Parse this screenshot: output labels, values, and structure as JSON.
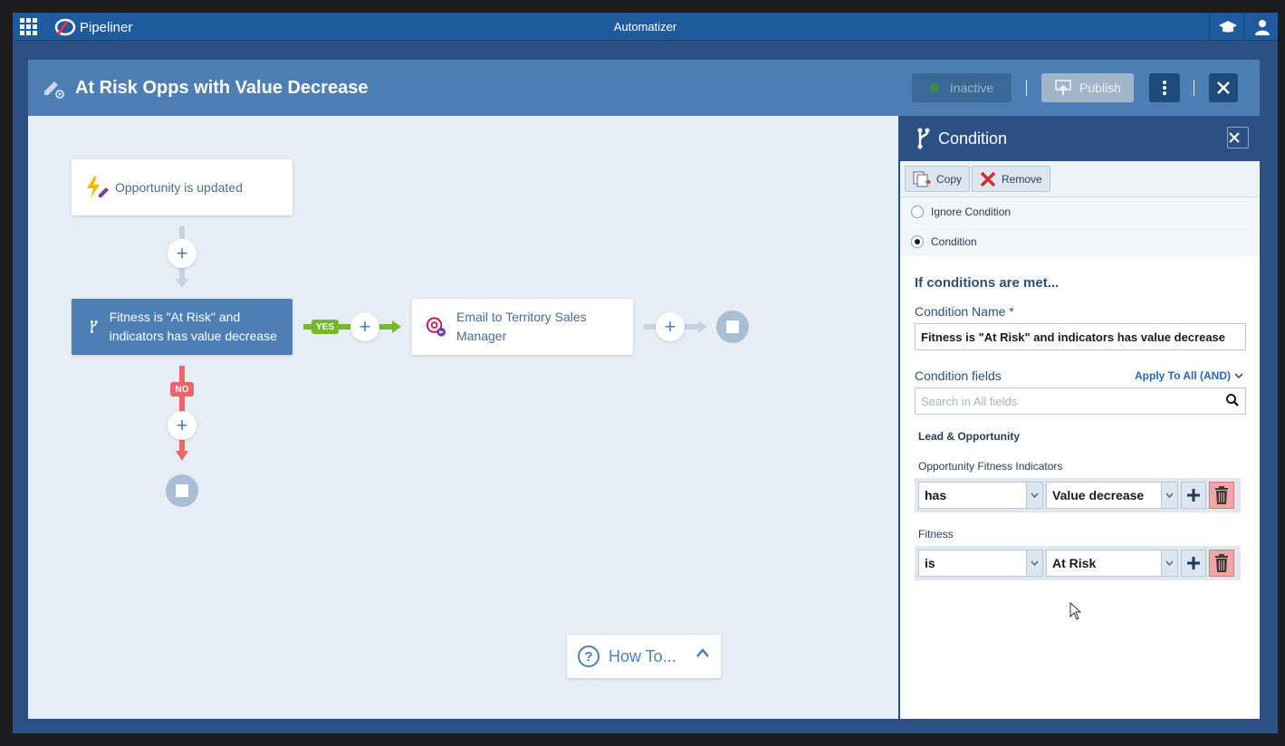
{
  "app": {
    "brand": "Pipeliner",
    "title": "Automatizer"
  },
  "workflow": {
    "title": "At Risk Opps with Value Decrease",
    "inactive_label": "Inactive",
    "publish_label": "Publish"
  },
  "canvas": {
    "trigger_label": "Opportunity is updated",
    "condition_label": "Fitness is \"At Risk\" and indicators has value decrease",
    "email_label": "Email to Territory Sales Manager",
    "yes_label": "YES",
    "no_label": "NO",
    "plus_glyph": "+",
    "howto_label": "How To..."
  },
  "panel": {
    "title": "Condition",
    "copy_label": "Copy",
    "remove_label": "Remove",
    "ignore_condition_label": "Ignore Condition",
    "condition_label": "Condition",
    "selected_option": "Condition",
    "if_heading": "If conditions are met...",
    "condition_name_label": "Condition Name *",
    "condition_name_value": "Fitness is \"At Risk\" and indicators has value decrease",
    "condition_fields_label": "Condition fields",
    "apply_all_label": "Apply To All (AND)",
    "search_placeholder": "Search in All fields",
    "group_label": "Lead & Opportunity",
    "fields": [
      {
        "label": "Opportunity Fitness Indicators",
        "operator": "has",
        "value": "Value decrease"
      },
      {
        "label": "Fitness",
        "operator": "is",
        "value": "At Risk"
      }
    ]
  },
  "colors": {
    "topbar": "#1f5a9c",
    "header": "#4e7fb4",
    "panel_header": "#2a5084",
    "yes": "#74b82d",
    "no": "#ec6668"
  }
}
